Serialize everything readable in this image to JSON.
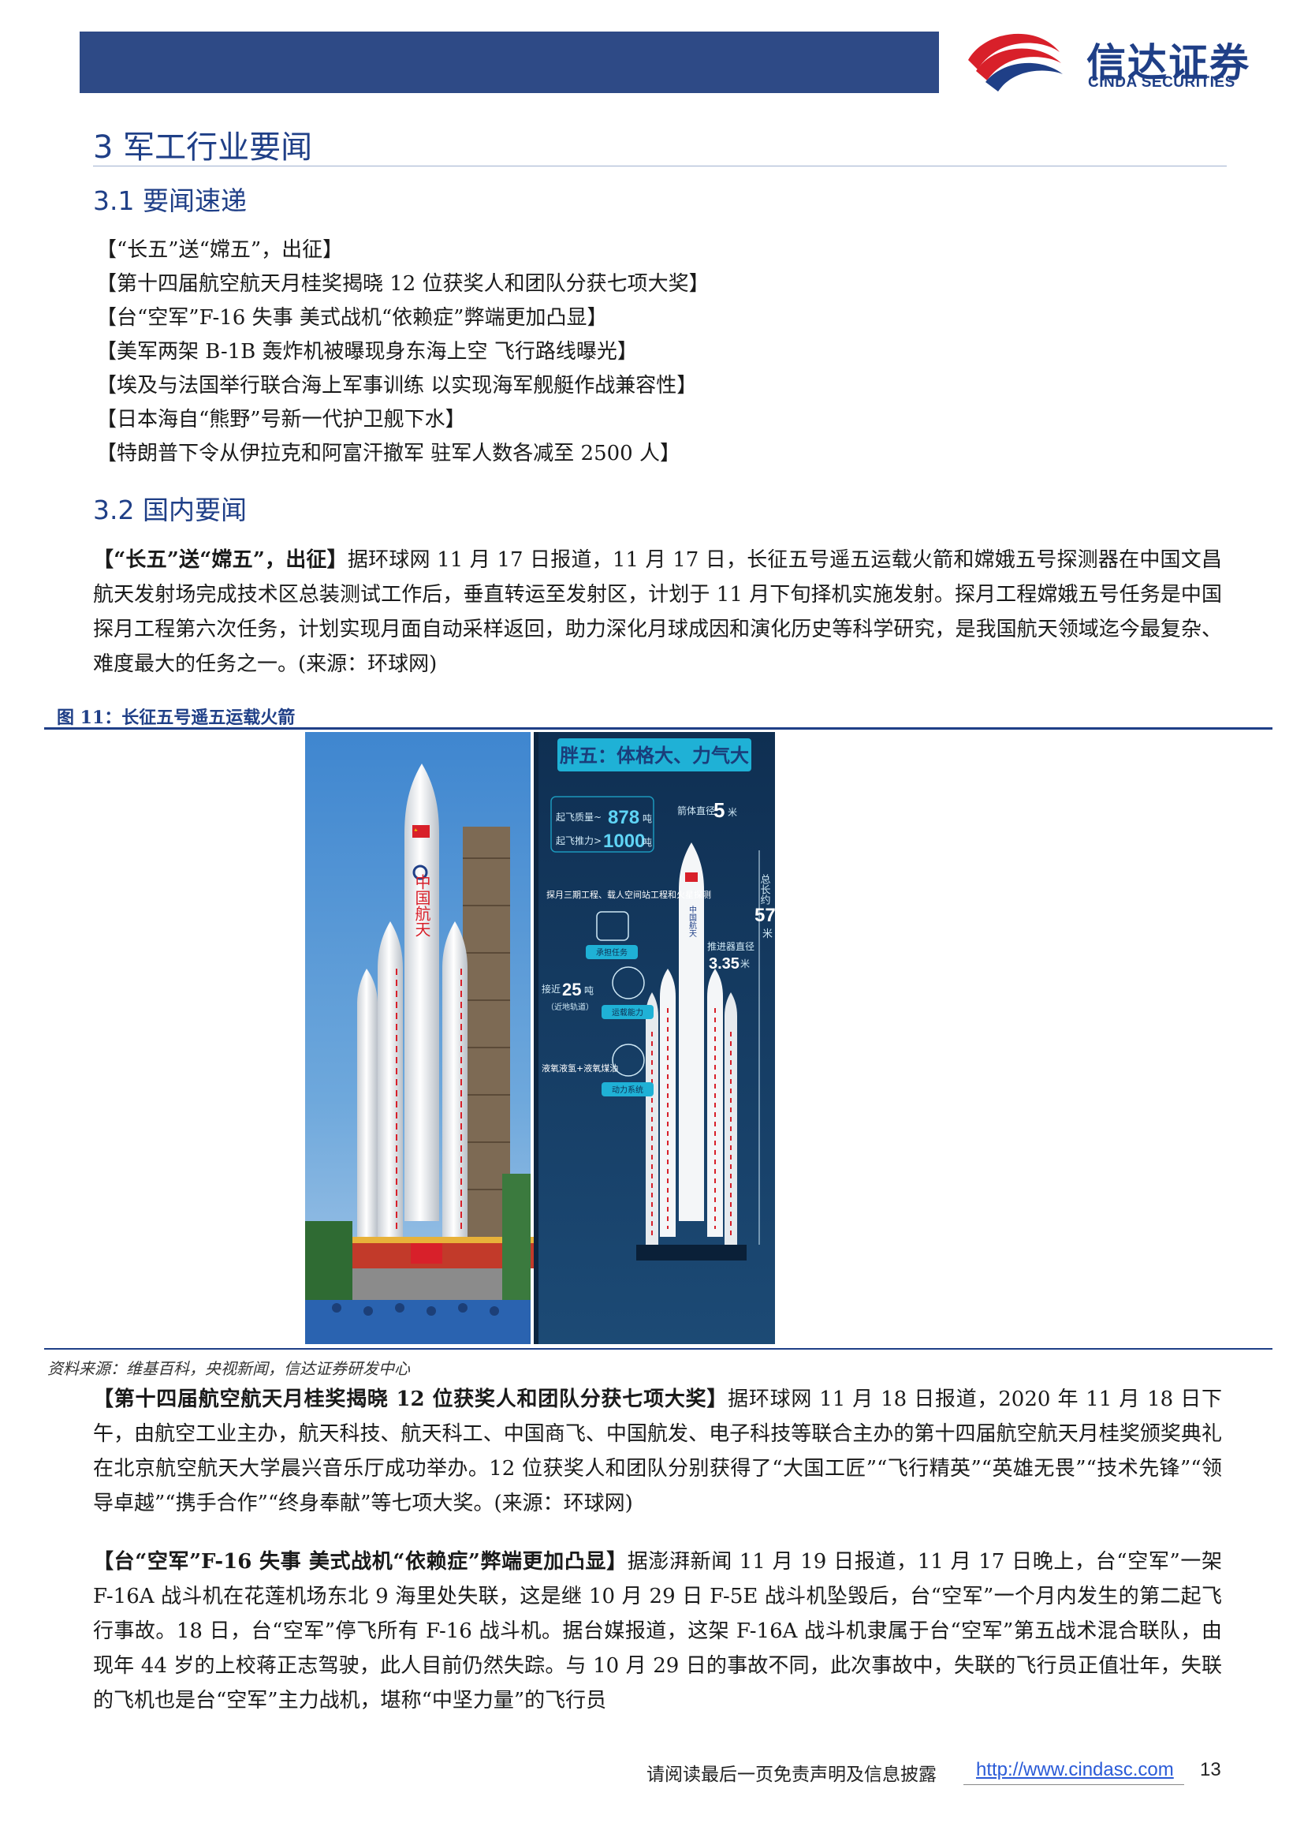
{
  "header": {
    "logo_cn": "信达证券",
    "logo_en": "CINDA SECURITIES",
    "colors": {
      "brand_blue": "#1f3f87",
      "header_bar": "#2e4a86",
      "brand_red": "#d8202a"
    }
  },
  "section": {
    "title": "3 军工行业要闻",
    "sub1": "3.1 要闻速递",
    "sub2": "3.2 国内要闻"
  },
  "toc": [
    "【“长五”送“嫦五”，出征】",
    "【第十四届航空航天月桂奖揭晓 12 位获奖人和团队分获七项大奖】",
    "【台“空军”F-16 失事 美式战机“依赖症”弊端更加凸显】",
    "【美军两架 B-1B 轰炸机被曝现身东海上空 飞行路线曝光】",
    "【埃及与法国举行联合海上军事训练 以实现海军舰艇作战兼容性】",
    "【日本海自“熊野”号新一代护卫舰下水】",
    "【特朗普下令从伊拉克和阿富汗撤军 驻军人数各减至 2500 人】"
  ],
  "news1": {
    "title": "【“长五”送“嫦五”，出征】",
    "body": "据环球网 11 月 17 日报道，11 月 17 日，长征五号遥五运载火箭和嫦娥五号探测器在中国文昌航天发射场完成技术区总装测试工作后，垂直转运至发射区，计划于 11 月下旬择机实施发射。探月工程嫦娥五号任务是中国探月工程第六次任务，计划实现月面自动采样返回，助力深化月球成因和演化历史等科学研究，是我国航天领域迄今最复杂、难度最大的任务之一。(来源：环球网)"
  },
  "figure": {
    "caption": "图 11：长征五号遥五运载火箭",
    "source": "资料来源：维基百科，央视新闻，信达证券研发中心",
    "infographic": {
      "title": "胖五：体格大、力气大",
      "flag_text": "CHN",
      "rocket_text": "中国航天",
      "takeoff_mass_label": "起飞质量~",
      "takeoff_mass_value": "878",
      "takeoff_mass_unit": "吨",
      "thrust_label": "起飞推力>",
      "thrust_value": "1000",
      "thrust_unit": "吨",
      "diameter_label": "箭体直径",
      "diameter_value": "5",
      "diameter_unit": "米",
      "length_label": "总长约",
      "length_value": "57",
      "length_unit": "米",
      "booster_label": "推进器直径",
      "booster_value": "3.35",
      "booster_unit": "米",
      "missions": "探月三期工程、载人空间站工程和火星探测",
      "missions_tag": "承担任务",
      "capacity_label": "接近",
      "capacity_value": "25",
      "capacity_unit": "吨",
      "capacity_note": "（近地轨道）",
      "capacity_tag": "运载能力",
      "fuel": "液氧液氢+液氧煤油",
      "fuel_tag": "动力系统",
      "colors": {
        "bg": "#143a63",
        "accent": "#1fb1d6",
        "title_text": "#1a3d7a"
      }
    }
  },
  "news2": {
    "title": "【第十四届航空航天月桂奖揭晓 12 位获奖人和团队分获七项大奖】",
    "body": "据环球网 11 月 18 日报道，2020 年 11 月 18 日下午，由航空工业主办，航天科技、航天科工、中国商飞、中国航发、电子科技等联合主办的第十四届航空航天月桂奖颁奖典礼在北京航空航天大学晨兴音乐厅成功举办。12 位获奖人和团队分别获得了“大国工匠”“飞行精英”“英雄无畏”“技术先锋”“领导卓越”“携手合作”“终身奉献”等七项大奖。(来源：环球网)"
  },
  "news3": {
    "title": "【台“空军”F-16 失事 美式战机“依赖症”弊端更加凸显】",
    "body": "据澎湃新闻 11 月 19 日报道，11 月 17 日晚上，台“空军”一架 F-16A 战斗机在花莲机场东北 9 海里处失联，这是继 10 月 29 日 F-5E 战斗机坠毁后，台“空军”一个月内发生的第二起飞行事故。18 日，台“空军”停飞所有 F-16 战斗机。据台媒报道，这架 F-16A 战斗机隶属于台“空军”第五战术混合联队，由现年 44 岁的上校蒋正志驾驶，此人目前仍然失踪。与 10 月 29 日的事故不同，此次事故中，失联的飞行员正值壮年，失联的飞机也是台“空军”主力战机，堪称“中坚力量”的飞行员"
  },
  "footer": {
    "note": "请阅读最后一页免责声明及信息披露",
    "url": "http://www.cindasc.com",
    "page": "13"
  }
}
